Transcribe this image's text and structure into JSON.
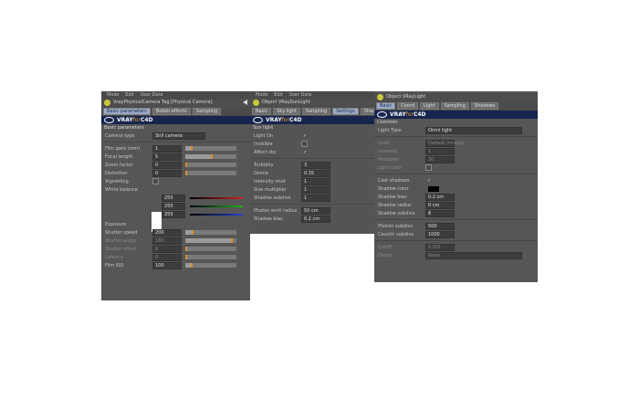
{
  "panel_a": {
    "menu": [
      "Mode",
      "Edit",
      "User Data"
    ],
    "title": "VrayPhysicalCamera Tag [Physical Camera]",
    "tabs": [
      {
        "label": "Basic parameters",
        "active": true
      },
      {
        "label": "Bokeh effects",
        "active": false
      },
      {
        "label": "Sampling",
        "active": false
      }
    ],
    "section": "Basic parameters",
    "type_label": "Camera type",
    "type_value": "Still camera",
    "rows": [
      {
        "label": "Film gate (mm)",
        "value": "1",
        "fill": 0.1
      },
      {
        "label": "Focal length",
        "value": "5",
        "fill": 0.5
      },
      {
        "label": "Zoom factor",
        "value": "0",
        "fill": 0.0
      },
      {
        "label": "Distortion",
        "value": "0",
        "fill": 0.0
      }
    ],
    "vignetting_label": "Vignetting",
    "wb_label": "White balance",
    "wb_values": [
      "255",
      "255",
      "255"
    ],
    "exposure_label": "Exposure",
    "rows2": [
      {
        "label": "Shutter speed",
        "value": "200",
        "fill": 0.12,
        "dim": false
      },
      {
        "label": "Shutter angle",
        "value": "180",
        "fill": 0.9,
        "dim": true
      },
      {
        "label": "Shutter offset",
        "value": "0",
        "fill": 0.0,
        "dim": true
      },
      {
        "label": "Latency",
        "value": "0",
        "fill": 0.0,
        "dim": true
      },
      {
        "label": "Film ISO",
        "value": "100",
        "fill": 0.1,
        "dim": false
      }
    ]
  },
  "panel_b": {
    "menu": [
      "Mode",
      "Edit",
      "User Data"
    ],
    "title": "Object VRaySunLight",
    "tabs": [
      {
        "label": "Basic",
        "active": false
      },
      {
        "label": "Sky light",
        "active": false
      },
      {
        "label": "Sampling",
        "active": false
      },
      {
        "label": "Settings",
        "active": true
      },
      {
        "label": "Shadows",
        "active": false
      }
    ],
    "section": "Sun light",
    "checks": [
      {
        "label": "Light On",
        "checked": true
      },
      {
        "label": "Invisible",
        "checked": false
      },
      {
        "label": "Affect sky",
        "checked": true
      }
    ],
    "fields": [
      {
        "label": "Turbidity",
        "value": "3"
      },
      {
        "label": "Ozone",
        "value": "0.35"
      },
      {
        "label": "Intensity mult",
        "value": "1"
      },
      {
        "label": "Size multiplier",
        "value": "1"
      },
      {
        "label": "Shadow subdivs",
        "value": "1"
      }
    ],
    "photon_label": "Photon emit radius",
    "photon_value": "50 cm",
    "shadow_bias_label": "Shadow bias",
    "shadow_bias_value": "0.2 cm"
  },
  "panel_c": {
    "title": "Object VRayLight",
    "tabs": [
      {
        "label": "Basic",
        "active": true
      },
      {
        "label": "Coord",
        "active": false
      },
      {
        "label": "Light",
        "active": false
      },
      {
        "label": "Sampling",
        "active": false
      },
      {
        "label": "Shadows",
        "active": false
      }
    ],
    "section": "Common",
    "type_label": "Light Type",
    "type_value": "Omni light",
    "rows": [
      {
        "label": "Units",
        "value": "Default (image)",
        "dim": true
      },
      {
        "label": "Intensity",
        "value": "1",
        "dim": true
      },
      {
        "label": "Multiplier",
        "value": "30",
        "dim": true
      },
      {
        "label": "Light color",
        "value": "",
        "dim": true
      }
    ],
    "shadows_label": "Cast shadows",
    "shadow_color_label": "Shadow color",
    "fields": [
      {
        "label": "Shadow bias",
        "value": "0.2 cm"
      },
      {
        "label": "Shadow radius",
        "value": "0 cm"
      },
      {
        "label": "Shadow subdivs",
        "value": "8"
      }
    ],
    "photon_fields": [
      {
        "label": "Photon subdivs",
        "value": "500"
      },
      {
        "label": "Caustic subdivs",
        "value": "1000"
      }
    ],
    "cutoff_label": "Cutoff",
    "cutoff_value": "0.001",
    "decay_label": "Decay",
    "decay_value": "None"
  }
}
